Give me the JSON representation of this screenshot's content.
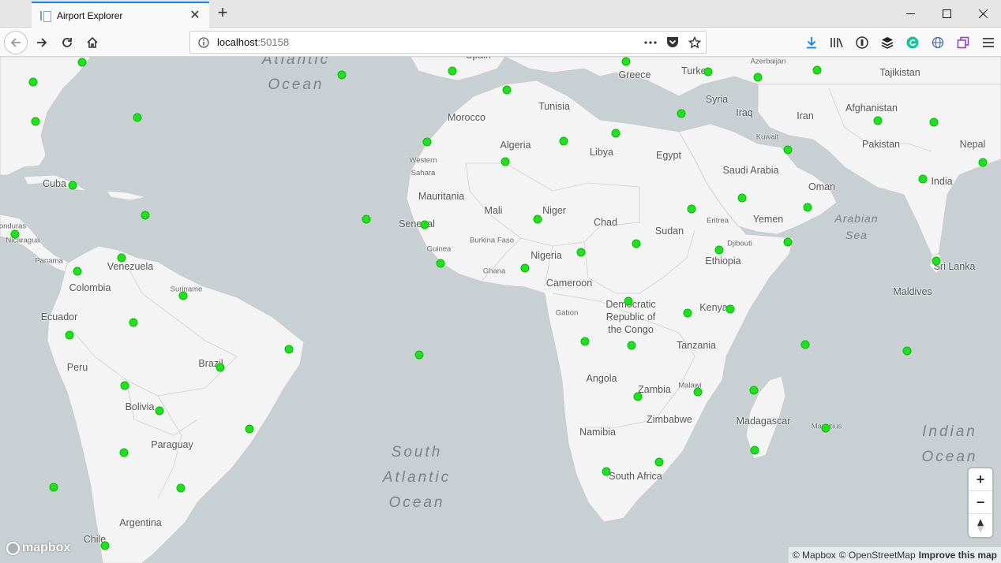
{
  "browser": {
    "tab_title": "Airport Explorer",
    "url_host": "localhost",
    "url_port": ":50158",
    "win_min": "—",
    "win_max": "☐",
    "win_close": "✕",
    "new_tab": "+"
  },
  "map": {
    "colors": {
      "water": "#c9d0d3",
      "land": "#f4f4f4",
      "border": "#c8c8c8",
      "marker": "#19e619"
    },
    "labels": {
      "atlantic": "Atlantic\nOcean",
      "south_atlantic": "South\nAtlantic\nOcean",
      "indian": "Indian\nOcean",
      "arabian_sea": "Arabian\nSea",
      "spain": "Spain",
      "greece": "Greece",
      "turkey": "Turkey",
      "azerbaijan": "Azerbaijan",
      "tajikistan": "Tajikistan",
      "tunisia": "Tunisia",
      "morocco": "Morocco",
      "syria": "Syria",
      "iraq": "Iraq",
      "iran": "Iran",
      "afghanistan": "Afghanistan",
      "algeria": "Algeria",
      "libya": "Libya",
      "egypt": "Egypt",
      "kuwait": "Kuwait",
      "pakistan": "Pakistan",
      "nepal": "Nepal",
      "western_sahara": "Western\nSahara",
      "saudi_arabia": "Saudi Arabia",
      "india": "India",
      "cuba": "Cuba",
      "mauritania": "Mauritania",
      "oman": "Oman",
      "mali": "Mali",
      "niger": "Niger",
      "chad": "Chad",
      "eritrea": "Eritrea",
      "yemen": "Yemen",
      "honduras": "onduras",
      "nicaragua": "Nicaragua",
      "senegal": "Senegal",
      "sudan": "Sudan",
      "burkina_faso": "Burkina Faso",
      "djibouti": "Djibouti",
      "guinea": "Guinea",
      "panama": "Panama",
      "venezuela": "Venezuela",
      "nigeria": "Nigeria",
      "ethiopia": "Ethiopia",
      "sri_lanka": "Sri Lanka",
      "ghana": "Ghana",
      "cameroon": "Cameroon",
      "colombia": "Colombia",
      "suriname": "Suriname",
      "maldives": "Maldives",
      "drc": "Democratic\nRepublic of\nthe Congo",
      "kenya": "Kenya",
      "ecuador": "Ecuador",
      "gabon": "Gabon",
      "tanzania": "Tanzania",
      "brazil": "Brazil",
      "peru": "Peru",
      "angola": "Angola",
      "malawi": "Malawi",
      "zambia": "Zambia",
      "bolivia": "Bolivia",
      "madagascar": "Madagascar",
      "zimbabwe": "Zimbabwe",
      "mauritius": "Mauritius",
      "namibia": "Namibia",
      "paraguay": "Paraguay",
      "south_africa": "South Africa",
      "argentina": "Argentina",
      "chile": "Chile"
    },
    "marker_count": 75,
    "zoom_in": "+",
    "zoom_out": "−",
    "compass": "▲",
    "logo_text": "mapbox",
    "attribution": {
      "mapbox": "© Mapbox",
      "osm": "© OpenStreetMap",
      "improve": "Improve this map"
    }
  }
}
